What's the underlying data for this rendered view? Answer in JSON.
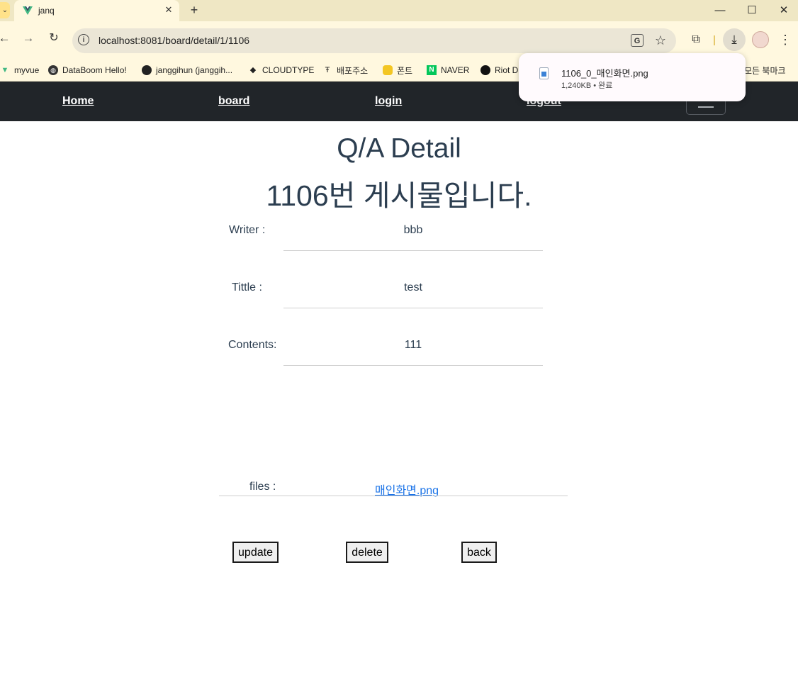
{
  "browser": {
    "tab_title": "janq",
    "tab_close": "✕",
    "new_tab": "+",
    "window_controls": {
      "minimize": "—",
      "maximize": "☐",
      "close": "✕"
    },
    "url": "localhost:8081/board/detail/1/1106",
    "bookmarks": [
      {
        "label": "myvue",
        "icon": "vue-icon"
      },
      {
        "label": "DataBoom Hello!",
        "icon": "globe-icon"
      },
      {
        "label": "janggihun (janggih...",
        "icon": "github-icon"
      },
      {
        "label": "CLOUDTYPE",
        "icon": "cloudtype-icon"
      },
      {
        "label": "배포주소",
        "icon": "pin-icon"
      },
      {
        "label": "폰트",
        "icon": "font-icon"
      },
      {
        "label": "NAVER",
        "icon": "naver-icon"
      },
      {
        "label": "Riot D",
        "icon": "riot-icon"
      }
    ],
    "all_bookmarks": "모든 북마크",
    "download": {
      "filename": "1106_0_매인화면.png",
      "status": "1,240KB • 완료"
    },
    "colors": {
      "tabstrip": "#efe7c4",
      "toolbar": "#fff8df",
      "omnibox": "#ebe6d6"
    }
  },
  "site_nav": {
    "links": [
      "Home",
      "board",
      "login",
      "logout"
    ],
    "background": "#212529"
  },
  "detail": {
    "title": "Q/A Detail",
    "subtitle": "1106번 게시물입니다.",
    "writer_label": "Writer :",
    "writer_value": "bbb",
    "title_label": "Tittle :",
    "title_value": "test",
    "contents_label": "Contents:",
    "contents_value": "111",
    "files_label": "files :",
    "file_name": "매인화면.png"
  },
  "buttons": {
    "update": "update",
    "delete": "delete",
    "back": "back"
  }
}
